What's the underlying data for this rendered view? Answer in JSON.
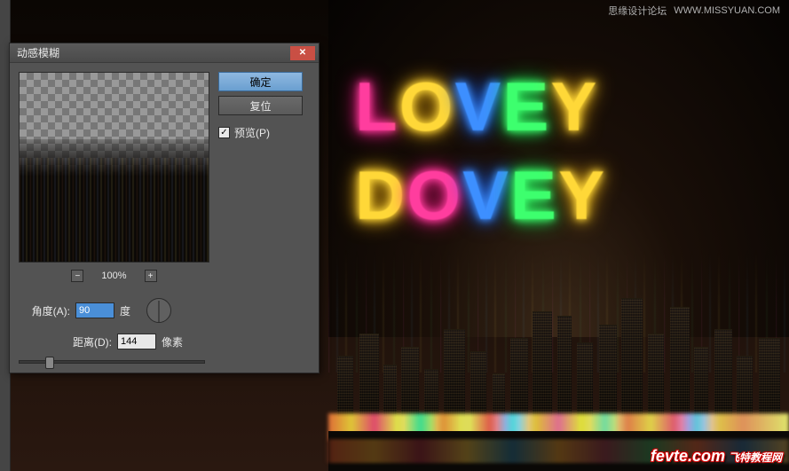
{
  "watermarks": {
    "top_text": "思缘设计论坛",
    "top_url": "WWW.MISSYUAN.COM",
    "bottom_main": "fevte.com",
    "bottom_sub": "飞特教程网"
  },
  "canvas": {
    "neon_line1": [
      "L",
      "O",
      "V",
      "E",
      "Y"
    ],
    "neon_line2": [
      "D",
      "O",
      "V",
      "E",
      "Y"
    ],
    "neon_colors1": [
      "c-pink",
      "c-yellow",
      "c-blue",
      "c-green",
      "c-yellow"
    ],
    "neon_colors2": [
      "c-yellow",
      "c-pink",
      "c-blue",
      "c-green",
      "c-yellow"
    ]
  },
  "dialog": {
    "title": "动感模糊",
    "ok_label": "确定",
    "reset_label": "复位",
    "preview_label": "预览(P)",
    "preview_checked": true,
    "zoom_value": "100%",
    "angle_label": "角度(A):",
    "angle_value": "90",
    "angle_unit": "度",
    "distance_label": "距离(D):",
    "distance_value": "144",
    "distance_unit": "像素",
    "slider_percent": 14
  }
}
